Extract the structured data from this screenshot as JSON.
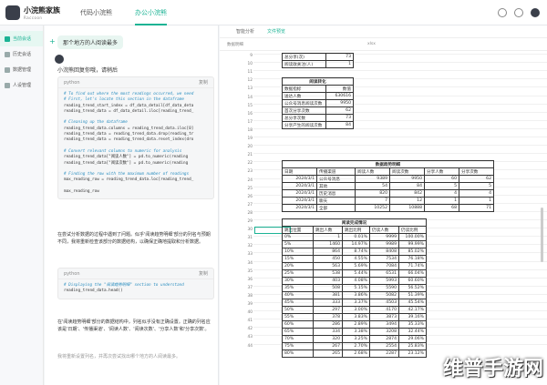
{
  "app": {
    "title": "小浣熊家族",
    "subtitle": "Raccoon"
  },
  "topbar": {
    "tabs": [
      "代码小浣熊",
      "办公小浣熊"
    ],
    "active": 1
  },
  "sidebar": {
    "items": [
      {
        "label": "当前会话",
        "active": true
      },
      {
        "label": "历史会话",
        "active": false
      },
      {
        "label": "数据管理",
        "active": false
      },
      {
        "label": "人设管理",
        "active": false
      }
    ]
  },
  "chat": {
    "user_msg": "那个地方的人阅读最多",
    "reply_intro": "小浣熊回复你哦，请稍后",
    "code1_lang": "python",
    "copy_label": "复制",
    "code1_lines": [
      "# To find out where the most readings occurred, we need",
      "# First, let's locate this section in the dataframe",
      "reading_trend_start_index = df_data_detail[df_data_deta",
      "reading_trend_data = df_data_detail.iloc[reading_trend_",
      "",
      "# Cleaning up the dataframe",
      "reading_trend_data.columns = reading_trend_data.iloc[0]",
      "reading_trend_data = reading_trend_data.drop(reading_tr",
      "reading_trend_data = reading_trend_data.reset_index(dro",
      "",
      "# Convert relevant columns to numeric for analysis",
      "reading_trend_data[\"阅读人数\"] = pd.to_numeric(reading",
      "reading_trend_data[\"阅读次数\"] = pd.to_numeric(reading",
      "",
      "# Finding the row with the maximum number of readings",
      "max_reading_row = reading_trend_data.loc[reading_trend_",
      "",
      "max_reading_row"
    ],
    "para1": "在尝试分析数据的过程中遇到了问题。似乎'阅读趋势明细'部分的列名与预期不同，我将重新检查该部分的数据结构，以确保正确地提取和分析数据。",
    "code2_lang": "python",
    "code2_lines": [
      "# Displaying the \"阅读趋势明细\" section to understand",
      "reading_trend_data.head()"
    ],
    "para2": "在'阅读趋势明细'部分的数据结构中，列名似乎没有正确设置。正确的列名应该是'日期'、'传播渠道'、'阅读人数'、'阅读次数'、'分享人数'和'分享次数'。",
    "para3": "我将重新设置列名，并再次尝试找出哪个地方的人阅读最多。"
  },
  "right": {
    "tabs": [
      "智能分析",
      "文件预览"
    ],
    "active_tab": 1,
    "file_label": "数据明细",
    "file_ext": "xlsx",
    "zoom": "打印"
  },
  "sheet": {
    "row_numbers": [
      "9",
      "10",
      "11",
      "12",
      "13",
      "14",
      "15",
      "16",
      "17",
      "18",
      "19",
      "20",
      "21",
      "22",
      "23",
      "24",
      "25",
      "26",
      "27",
      "28",
      "29",
      "30",
      "31",
      "32",
      "33",
      "34",
      "35",
      "36",
      "37",
      "38",
      "39",
      "40",
      "41",
      "42",
      "43",
      "44"
    ],
    "top_rows": [
      [
        "总分享(次)",
        "73"
      ],
      [
        "阅读收关注(人)",
        "1"
      ]
    ],
    "t1_title": "阅读转化",
    "t1_rows": [
      [
        "数据指标",
        "数值"
      ],
      [
        "送达人数",
        "630616"
      ],
      [
        "公众号消息阅读次数",
        "9950"
      ],
      [
        "首次分享次数",
        "62"
      ],
      [
        "总分享次数",
        "73"
      ],
      [
        "分享产生的阅读次数",
        "84"
      ]
    ],
    "t2_title": "数据趋势明细",
    "t2_header": [
      "日期",
      "传播渠道",
      "阅读人数",
      "阅读次数",
      "分享人数",
      "分享次数"
    ],
    "t2_rows": [
      [
        "2024/3/1",
        "公众号消息",
        "9389",
        "9950",
        "60",
        "62"
      ],
      [
        "2024/3/1",
        "其他",
        "54",
        "84",
        "5",
        "5"
      ],
      [
        "2024/3/1",
        "历史消息",
        "820",
        "842",
        "4",
        "4"
      ],
      [
        "2024/3/1",
        "聊天",
        "7",
        "12",
        "1",
        "1"
      ],
      [
        "2024/3/1",
        "全部",
        "10252",
        "10888",
        "68",
        "71"
      ]
    ],
    "t3_title": "阅读完成情况",
    "t3_header": [
      "跳出位置",
      "跳出人数",
      "跳出比例",
      "仍读人数",
      "仍读比例"
    ],
    "t3_rows": [
      [
        "0%",
        "1",
        "0.01%",
        "9999",
        "100.00%"
      ],
      [
        "5%",
        "1460",
        "14.97%",
        "9989",
        "99.99%"
      ],
      [
        "10%",
        "864",
        "8.74%",
        "8408",
        "85.02%"
      ],
      [
        "15%",
        "450",
        "4.55%",
        "7534",
        "76.18%"
      ],
      [
        "20%",
        "563",
        "5.69%",
        "7084",
        "71.74%"
      ],
      [
        "25%",
        "538",
        "5.44%",
        "6531",
        "66.04%"
      ],
      [
        "30%",
        "403",
        "4.08%",
        "5993",
        "60.60%"
      ],
      [
        "35%",
        "508",
        "5.15%",
        "5590",
        "56.52%"
      ],
      [
        "40%",
        "381",
        "3.86%",
        "5082",
        "51.39%"
      ],
      [
        "45%",
        "333",
        "3.37%",
        "4503",
        "45.54%"
      ],
      [
        "50%",
        "297",
        "3.00%",
        "4170",
        "42.17%"
      ],
      [
        "55%",
        "378",
        "3.83%",
        "3873",
        "39.16%"
      ],
      [
        "60%",
        "286",
        "2.89%",
        "3494",
        "35.33%"
      ],
      [
        "65%",
        "334",
        "3.38%",
        "3208",
        "32.44%"
      ],
      [
        "70%",
        "320",
        "3.25%",
        "2874",
        "29.06%"
      ],
      [
        "75%",
        "267",
        "2.70%",
        "2554",
        "25.83%"
      ],
      [
        "80%",
        "265",
        "2.68%",
        "2287",
        "23.12%"
      ]
    ]
  },
  "watermark": "维普手游网"
}
